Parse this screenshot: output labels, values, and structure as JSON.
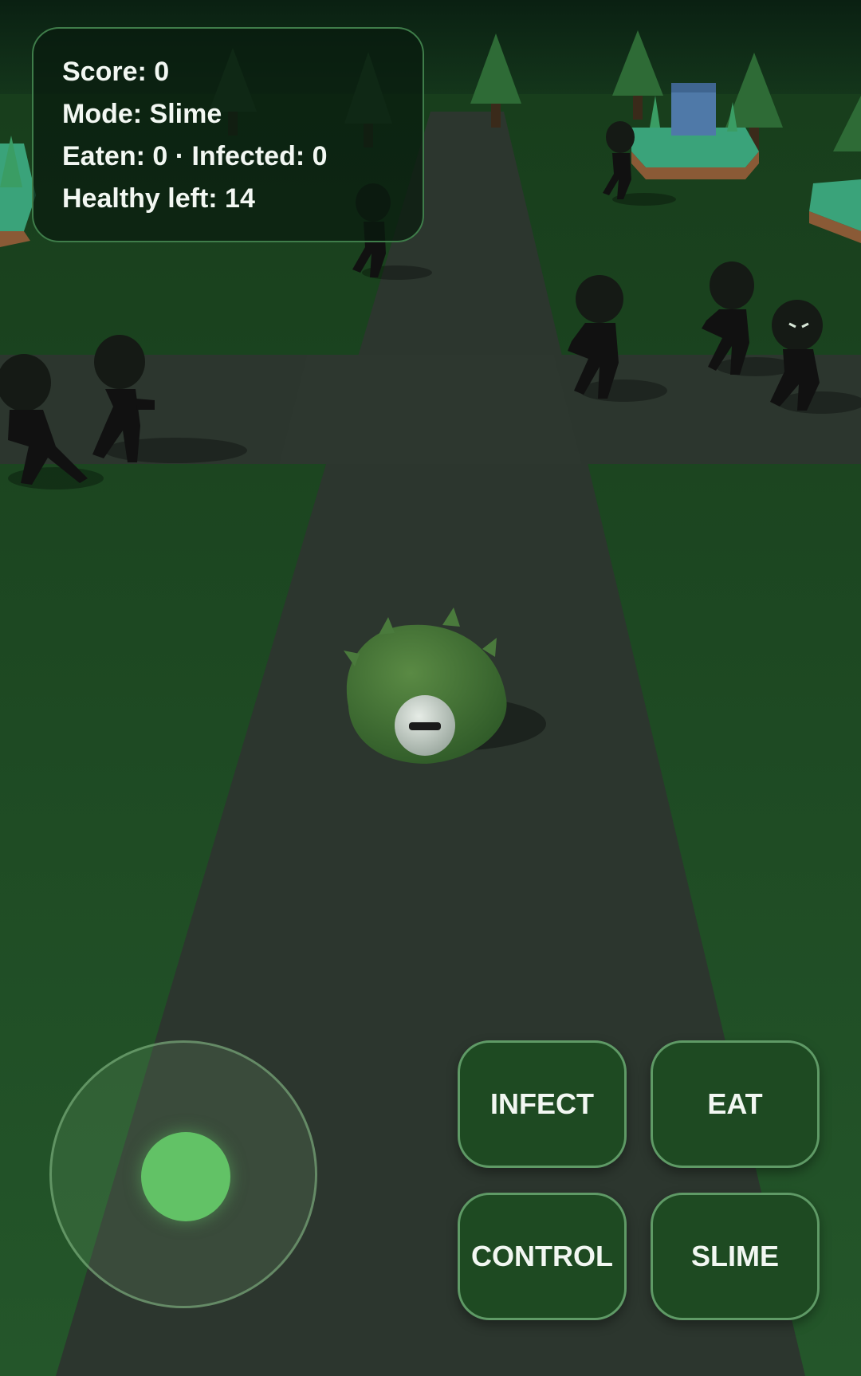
{
  "hud": {
    "score": "Score: 0",
    "mode": "Mode: Slime",
    "counts": "Eaten: 0 · Infected: 0",
    "healthy": "Healthy left: 14"
  },
  "controls": {
    "infect_label": "INFECT",
    "eat_label": "EAT",
    "control_label": "CONTROL",
    "slime_label": "SLIME"
  },
  "joystick": {
    "deflection": 0
  },
  "colors": {
    "grass": "#1f4a22",
    "road": "#2c362e",
    "sky": "#0c2414",
    "button_fill": "#1e4a22",
    "button_border": "#5f9a66",
    "joystick_knob": "#62c266",
    "slime_body": "#3f6f33"
  }
}
